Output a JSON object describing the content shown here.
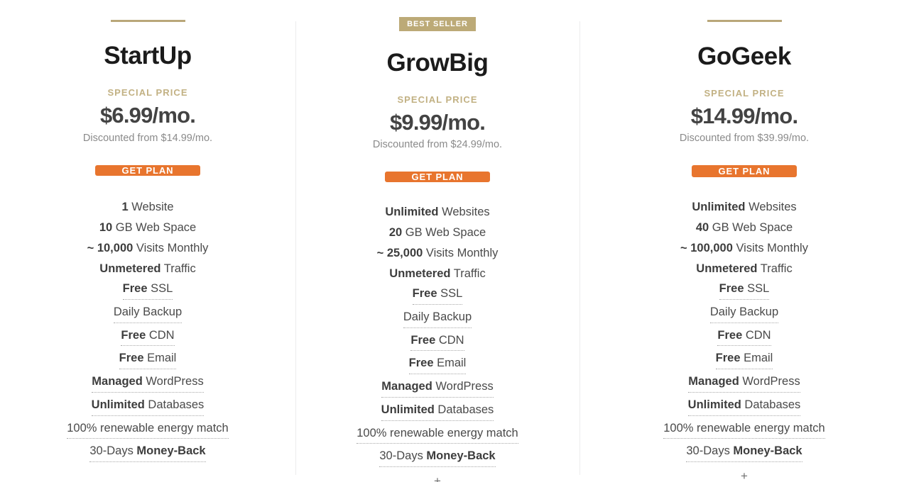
{
  "plans": [
    {
      "id": "startup",
      "accent_type": "rule",
      "badge_label": "",
      "name": "StartUp",
      "special_price_label": "SPECIAL PRICE",
      "price": "$6.99/mo.",
      "discounted_from": "Discounted from $14.99/mo.",
      "cta_label": "GET PLAN",
      "expander_label": "+",
      "expander_visible": false,
      "features": [
        {
          "strong": "1",
          "rest": " Website",
          "tooltip": false
        },
        {
          "strong": "10",
          "rest": " GB Web Space",
          "tooltip": false
        },
        {
          "strong": "~ 10,000",
          "rest": " Visits Monthly",
          "tooltip": false
        },
        {
          "strong": "Unmetered",
          "rest": " Traffic",
          "tooltip": false
        },
        {
          "strong": "Free",
          "rest": " SSL",
          "tooltip": true
        },
        {
          "strong": "",
          "rest": "Daily Backup",
          "tooltip": true
        },
        {
          "strong": "Free",
          "rest": " CDN",
          "tooltip": true
        },
        {
          "strong": "Free",
          "rest": " Email",
          "tooltip": true
        },
        {
          "strong": "Managed",
          "rest": " WordPress",
          "tooltip": true
        },
        {
          "strong": "Unlimited",
          "rest": " Databases",
          "tooltip": true
        },
        {
          "strong": "",
          "rest": "100% renewable energy match",
          "tooltip": true
        },
        {
          "strong": "",
          "rest": "30-Days ",
          "strong_after": "Money-Back",
          "tooltip": true
        }
      ]
    },
    {
      "id": "growbig",
      "accent_type": "badge",
      "badge_label": "BEST SELLER",
      "name": "GrowBig",
      "special_price_label": "SPECIAL PRICE",
      "price": "$9.99/mo.",
      "discounted_from": "Discounted from $24.99/mo.",
      "cta_label": "GET PLAN",
      "expander_label": "+",
      "expander_visible": true,
      "features": [
        {
          "strong": "Unlimited",
          "rest": " Websites",
          "tooltip": false
        },
        {
          "strong": "20",
          "rest": " GB Web Space",
          "tooltip": false
        },
        {
          "strong": "~ 25,000",
          "rest": " Visits Monthly",
          "tooltip": false
        },
        {
          "strong": "Unmetered",
          "rest": " Traffic",
          "tooltip": false
        },
        {
          "strong": "Free",
          "rest": " SSL",
          "tooltip": true
        },
        {
          "strong": "",
          "rest": "Daily Backup",
          "tooltip": true
        },
        {
          "strong": "Free",
          "rest": " CDN",
          "tooltip": true
        },
        {
          "strong": "Free",
          "rest": " Email",
          "tooltip": true
        },
        {
          "strong": "Managed",
          "rest": " WordPress",
          "tooltip": true
        },
        {
          "strong": "Unlimited",
          "rest": " Databases",
          "tooltip": true
        },
        {
          "strong": "",
          "rest": "100% renewable energy match",
          "tooltip": true
        },
        {
          "strong": "",
          "rest": "30-Days ",
          "strong_after": "Money-Back",
          "tooltip": true
        }
      ]
    },
    {
      "id": "gogeek",
      "accent_type": "rule",
      "badge_label": "",
      "name": "GoGeek",
      "special_price_label": "SPECIAL PRICE",
      "price": "$14.99/mo.",
      "discounted_from": "Discounted from $39.99/mo.",
      "cta_label": "GET PLAN",
      "expander_label": "+",
      "expander_visible": true,
      "features": [
        {
          "strong": "Unlimited",
          "rest": " Websites",
          "tooltip": false
        },
        {
          "strong": "40",
          "rest": " GB Web Space",
          "tooltip": false
        },
        {
          "strong": "~ 100,000",
          "rest": " Visits Monthly",
          "tooltip": false
        },
        {
          "strong": "Unmetered",
          "rest": " Traffic",
          "tooltip": false
        },
        {
          "strong": "Free",
          "rest": " SSL",
          "tooltip": true
        },
        {
          "strong": "",
          "rest": "Daily Backup",
          "tooltip": true
        },
        {
          "strong": "Free",
          "rest": " CDN",
          "tooltip": true
        },
        {
          "strong": "Free",
          "rest": " Email",
          "tooltip": true
        },
        {
          "strong": "Managed",
          "rest": " WordPress",
          "tooltip": true
        },
        {
          "strong": "Unlimited",
          "rest": " Databases",
          "tooltip": true
        },
        {
          "strong": "",
          "rest": "100% renewable energy match",
          "tooltip": true
        },
        {
          "strong": "",
          "rest": "30-Days ",
          "strong_after": "Money-Back",
          "tooltip": true
        }
      ]
    }
  ],
  "colors": {
    "cta_background": "#e8752e",
    "cta_text": "#ffffff",
    "badge_background": "#bcaa77",
    "accent_rule": "#b9a779",
    "special_price_text": "#c2b183",
    "price_text": "#434343",
    "discount_text": "#8a8a8a",
    "feature_text": "#4a4a4a",
    "divider": "#ececed"
  }
}
